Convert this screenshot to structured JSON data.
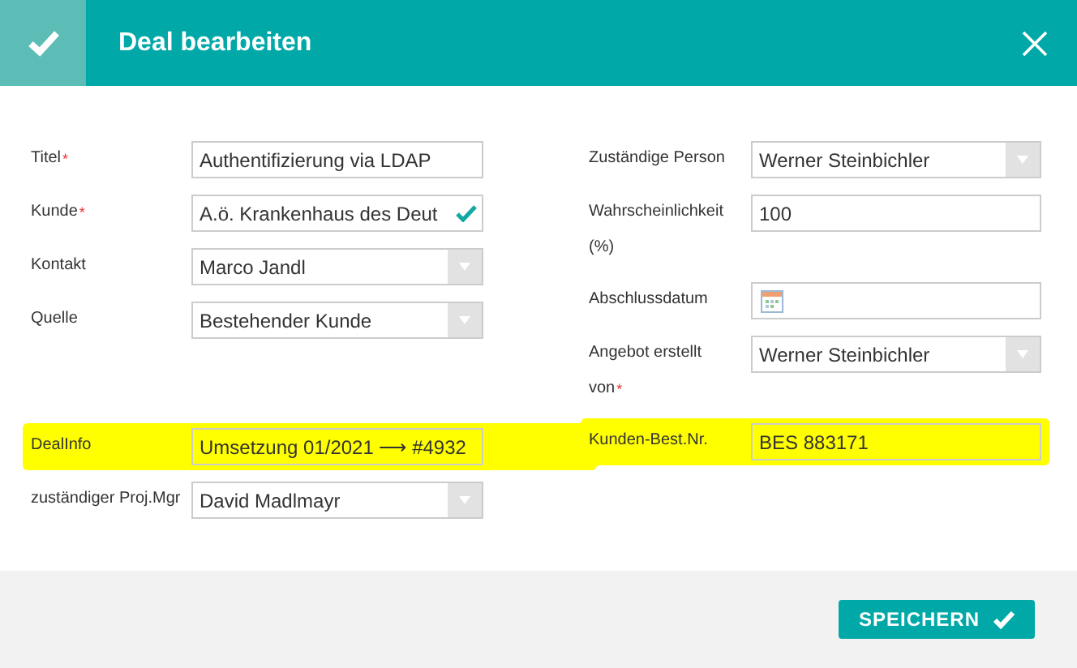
{
  "dialog": {
    "title": "Deal bearbeiten"
  },
  "left_column": {
    "groups": [
      [
        {
          "label": "Titel",
          "required_mark": "*",
          "kind": "text",
          "value": "Authentifizierung via LDAP",
          "highlighted": false
        },
        {
          "label": "Kunde",
          "required_mark": "*",
          "kind": "validated",
          "value": "A.ö. Krankenhaus des Deut",
          "highlighted": false
        },
        {
          "label": "Kontakt",
          "kind": "select",
          "value": "Marco Jandl",
          "highlighted": false
        },
        {
          "label": "Quelle",
          "kind": "select",
          "value": "Bestehender Kunde",
          "highlighted": false
        }
      ],
      [
        {
          "label": "DealInfo",
          "kind": "text",
          "value": "Umsetzung 01/2021 ⟶ #4932",
          "highlighted": true
        },
        {
          "label": "zuständiger Proj.Mgr",
          "kind": "select",
          "value": "David Madlmayr",
          "highlighted": false
        }
      ]
    ]
  },
  "right_column": {
    "rows": [
      {
        "label": "Zuständige Person",
        "kind": "select",
        "value": "Werner Steinbichler",
        "highlighted": false
      },
      {
        "label": "Wahrscheinlichkeit (%)",
        "kind": "text",
        "value": "100",
        "highlighted": false
      },
      {
        "label": "Abschlussdatum",
        "kind": "date",
        "highlighted": false
      },
      {
        "label": "Angebot erstellt von",
        "required_mark": "*",
        "kind": "select",
        "value": "Werner Steinbichler",
        "highlighted": false
      },
      {
        "label": "Kunden-Best.Nr.",
        "kind": "text",
        "value": "BES 883171",
        "highlighted": true
      }
    ]
  },
  "footer": {
    "save_button": "SPEICHERN"
  }
}
